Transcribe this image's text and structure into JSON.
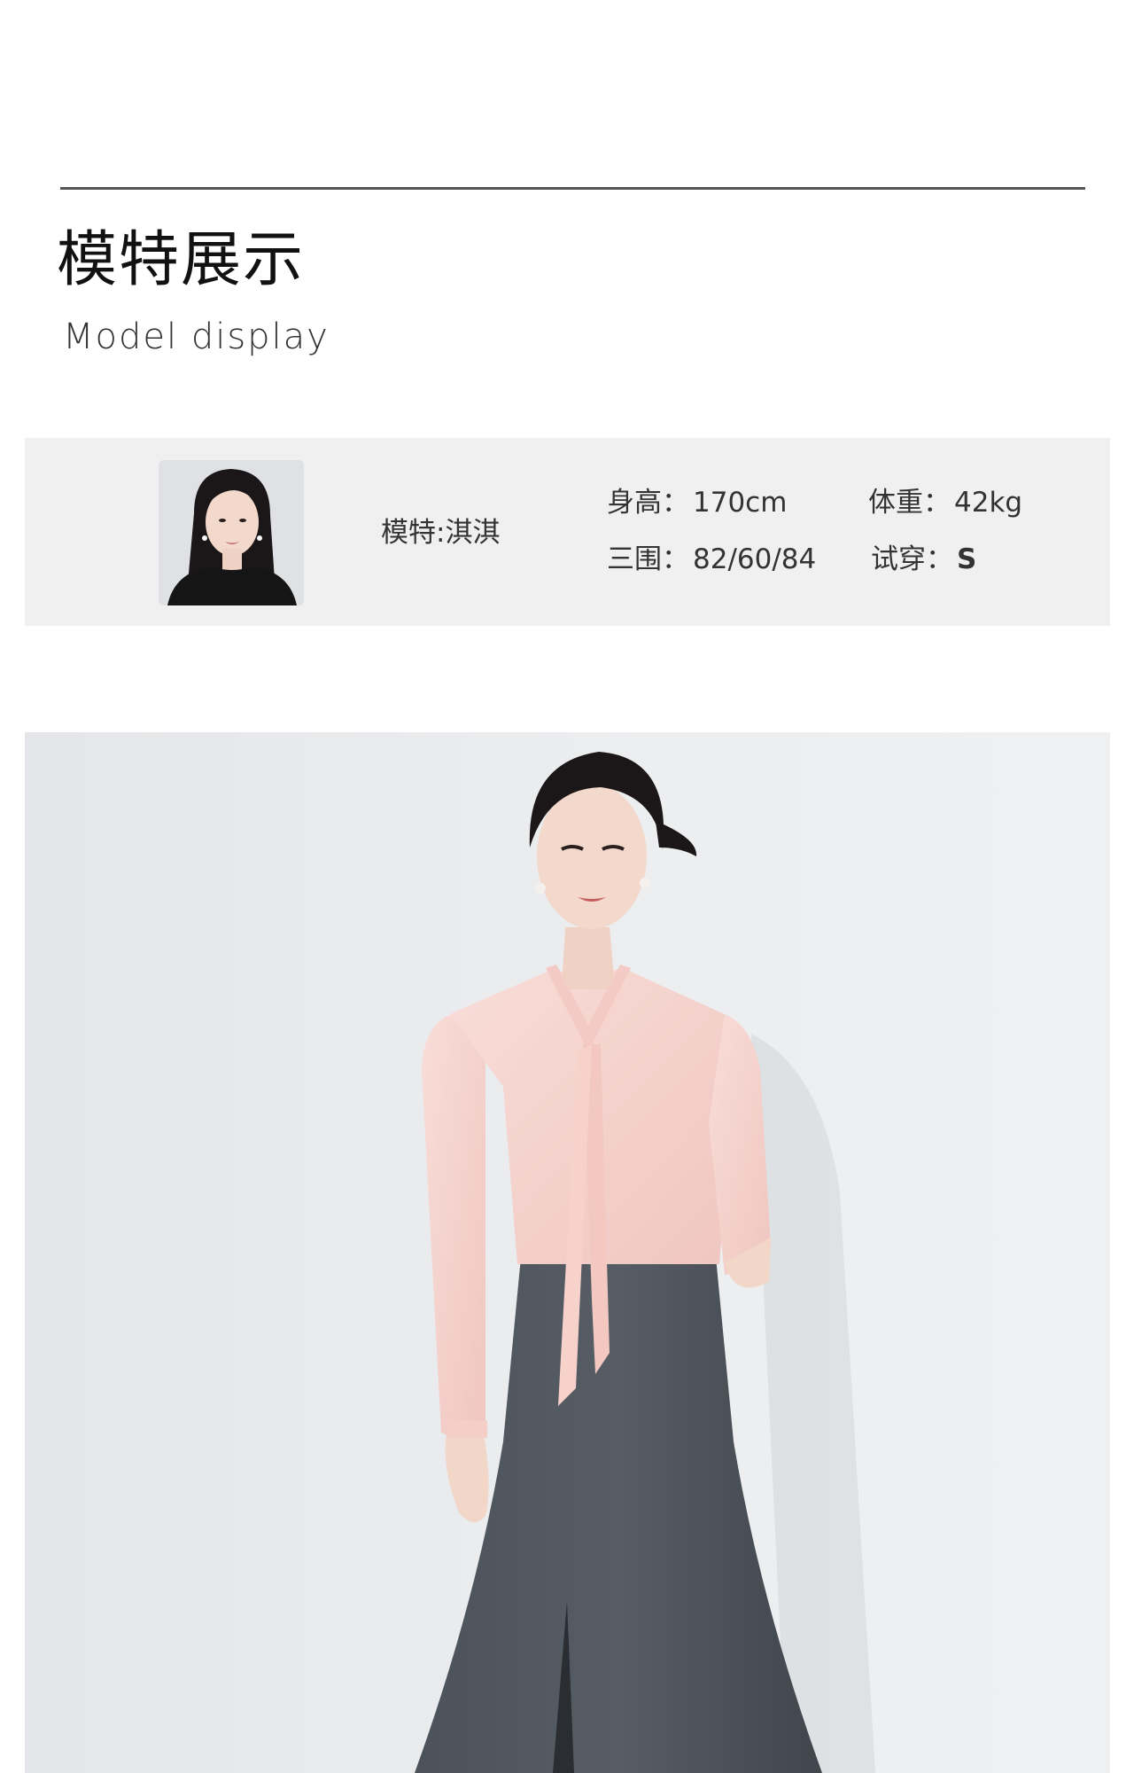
{
  "header": {
    "title_cn": "模特展示",
    "title_en": "Model display"
  },
  "model": {
    "name_label": "模特:淇淇",
    "height_label": "身高：",
    "height_value": "170cm",
    "weight_label": "体重：",
    "weight_value": "42kg",
    "measurements_label": "三围：",
    "measurements_value": "82/60/84",
    "size_label": "试穿：",
    "size_value": "S"
  },
  "colors": {
    "divider": "#555555",
    "info_bg": "#f0f0f0",
    "photo_bg": "#eceef0",
    "blouse": "#f7d3cd",
    "skirt": "#4a5058",
    "hair": "#1b1718",
    "skin": "#f2d6c8"
  }
}
